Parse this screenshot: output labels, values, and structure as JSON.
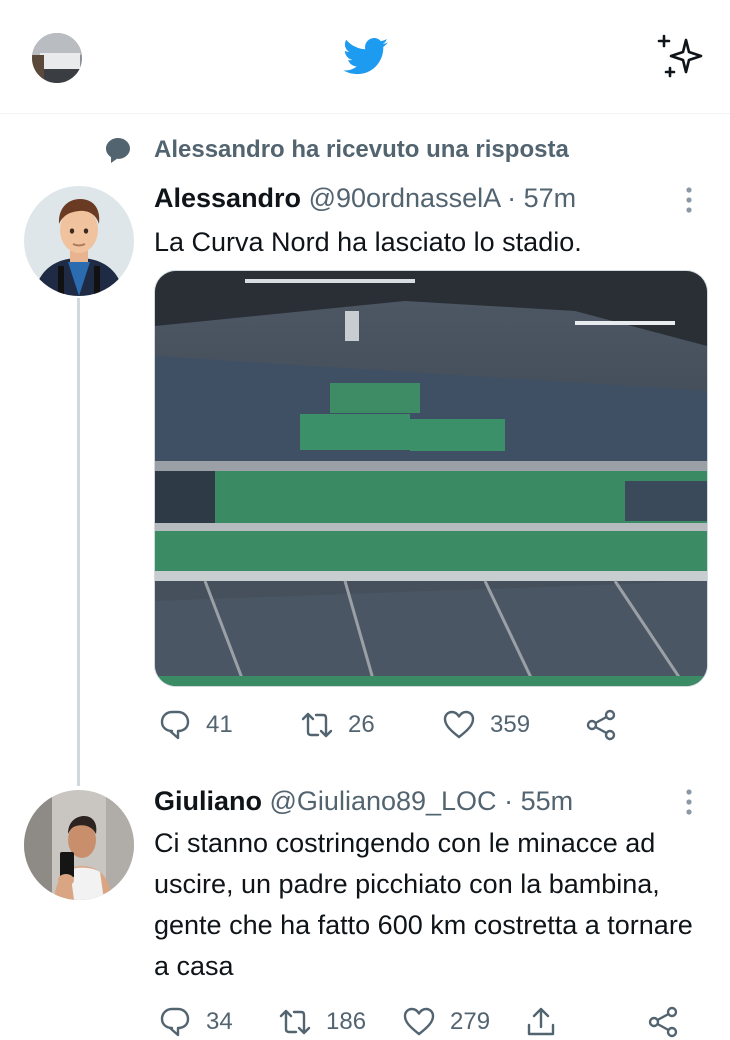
{
  "app": {
    "brand_icon": "twitter-bird-icon",
    "brand_color": "#1d9bf0"
  },
  "social_context": {
    "text": "Alessandro ha ricevuto una risposta",
    "icon": "speech-bubble-icon"
  },
  "tweets": [
    {
      "name": "Alessandro",
      "handle": "@90ordnasselA",
      "sep": "·",
      "time": "57m",
      "text": "La Curva Nord ha lasciato lo stadio.",
      "has_media": true,
      "replies": "41",
      "retweets": "26",
      "likes": "359"
    },
    {
      "name": "Giuliano",
      "handle": "@Giuliano89_LOC",
      "sep": "·",
      "time": "55m",
      "text": "Ci stanno costringendo con le minacce ad uscire, un padre picchiato con la bambina, gente che ha fatto 600 km costretta a tornare a casa",
      "replies": "34",
      "retweets": "186",
      "likes": "279"
    }
  ]
}
